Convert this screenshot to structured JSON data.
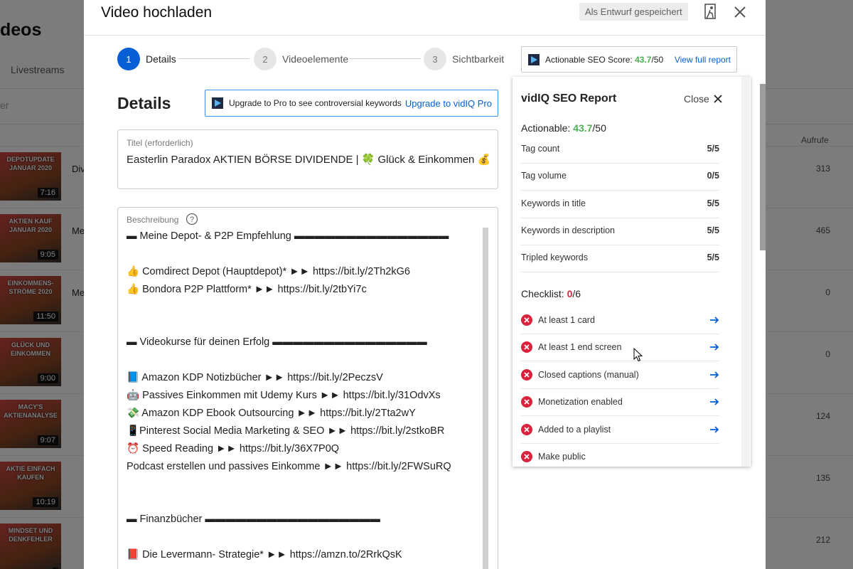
{
  "background": {
    "page_title": "deos",
    "tab": "Livestreams",
    "filter": "er",
    "views_header": "Aufrufe",
    "rows": [
      {
        "caption": "DEPOTUPDATE JANUAR 2020",
        "duration": "7:16",
        "title": "Div",
        "views": "313"
      },
      {
        "caption": "AKTIEN KAUF JANUAR 2020",
        "duration": "9:05",
        "title": "Me",
        "views": "465"
      },
      {
        "caption": "EINKOMMENS-STRÖME 2020",
        "duration": "11:50",
        "title": "Me",
        "views": "0"
      },
      {
        "caption": "GLÜCK UND EINKOMMEN",
        "duration": "9:00",
        "title": "",
        "views": "0"
      },
      {
        "caption": "MACY'S AKTIENANALYSE",
        "duration": "9:07",
        "title": "",
        "views": "124"
      },
      {
        "caption": "AKTIE EINFACH KAUFEN",
        "duration": "10:19",
        "title": "",
        "views": "135"
      },
      {
        "caption": "MINDSET UND DENKFEHLER",
        "duration": "",
        "title": "",
        "views": "212"
      }
    ]
  },
  "dialog": {
    "title": "Video hochladen",
    "draft_status": "Als Entwurf gespeichert",
    "steps": [
      {
        "number": "1",
        "label": "Details"
      },
      {
        "number": "2",
        "label": "Videoelemente"
      },
      {
        "number": "3",
        "label": "Sichtbarkeit"
      }
    ],
    "seo_score": {
      "label": "Actionable SEO Score:",
      "score": "43.7",
      "max": "/50",
      "link": "View full report"
    },
    "details_heading": "Details",
    "upgrade": {
      "text": "Upgrade to Pro to see controversial keywords",
      "link": "Upgrade to vidIQ Pro"
    },
    "title_field": {
      "label": "Titel (erforderlich)",
      "value": "Easterlin Paradox AKTIEN BÖRSE DIVIDENDE | 🍀 Glück & Einkommen 💰"
    },
    "description_field": {
      "label": "Beschreibung",
      "lines": [
        "▬ Meine Depot- & P2P Empfehlung ▬▬▬▬▬▬▬▬▬▬▬▬▬▬▬",
        "",
        "👍 Comdirect Depot (Hauptdepot)* ►► https://bit.ly/2Th2kG6",
        "👍 Bondora P2P Plattform* ►► https://bit.ly/2tbYi7c",
        "",
        "",
        "▬ Videokurse für deinen Erfolg ▬▬▬▬▬▬▬▬▬▬▬▬▬▬▬",
        "",
        "📘 Amazon KDP Notizbücher ►► https://bit.ly/2PeczsV",
        "🤖 Passives Einkommen mit Udemy Kurs ►► https://bit.ly/31OdvXs",
        "💸 Amazon KDP Ebook Outsourcing ►► https://bit.ly/2Tta2wY",
        "📱Pinterest Social Media Marketing & SEO ►► https://bit.ly/2stkoBR",
        "⏰ Speed Reading ►► https://bit.ly/36X7P0Q",
        "Podcast erstellen und passives Einkomme ►► https://bit.ly/2FWSuRQ",
        "",
        "",
        "▬ Finanzbücher ▬▬▬▬▬▬▬▬▬▬▬▬▬▬▬▬▬",
        "",
        "📕 Die Levermann- Strategie* ►► https://amzn.to/2RrkQsK"
      ]
    }
  },
  "vidiq": {
    "title": "vidIQ SEO Report",
    "close_label": "Close",
    "actionable_label": "Actionable:",
    "actionable_score": "43.7",
    "actionable_max": "/50",
    "metrics": [
      {
        "name": "Tag count",
        "value": "5/5"
      },
      {
        "name": "Tag volume",
        "value": "0/5"
      },
      {
        "name": "Keywords in title",
        "value": "5/5"
      },
      {
        "name": "Keywords in description",
        "value": "5/5"
      },
      {
        "name": "Tripled keywords",
        "value": "5/5"
      }
    ],
    "checklist_label": "Checklist:",
    "checklist_done": "0",
    "checklist_total": "/6",
    "checklist": [
      {
        "name": "At least 1 card"
      },
      {
        "name": "At least 1 end screen"
      },
      {
        "name": "Closed captions (manual)"
      },
      {
        "name": "Monetization enabled"
      },
      {
        "name": "Added to a playlist"
      },
      {
        "name": "Make public"
      }
    ]
  },
  "colors": {
    "accent_blue": "#065fd4",
    "score_green": "#4caf50",
    "error_red": "#d9233c"
  }
}
